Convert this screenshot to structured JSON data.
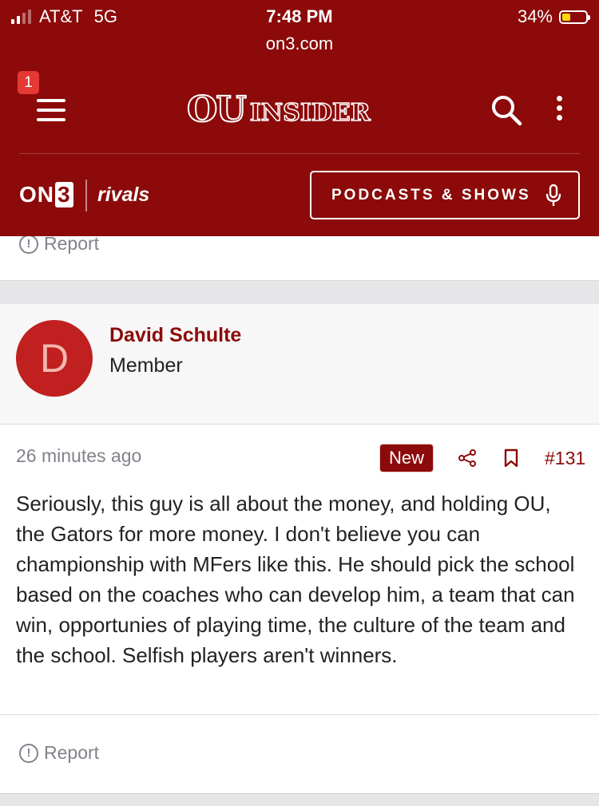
{
  "status_bar": {
    "carrier": "AT&T",
    "network": "5G",
    "time": "7:48 PM",
    "battery": "34%",
    "battery_level": 0.34
  },
  "url": "on3.com",
  "header": {
    "notification_count": "1",
    "logo_ou": "OU",
    "logo_insider": "INSIDER",
    "on3_label": "ON",
    "on3_num": "3",
    "rivals_label": "rivals",
    "podcasts_label": "PODCASTS & SHOWS"
  },
  "previous_post": {
    "report_label": "Report"
  },
  "post": {
    "author": {
      "initial": "D",
      "name": "David Schulte",
      "role": "Member"
    },
    "time_ago": "26 minutes ago",
    "new_badge": "New",
    "number": "#131",
    "body": "Seriously, this guy is all about the money, and holding OU, the Gators for more money. I don't believe you can championship with MFers like this. He should pick the school based on the coaches who can develop him, a team that can win, opportunies of playing time, the culture of the team and the school. Selfish players aren't winners.",
    "report_label": "Report"
  },
  "colors": {
    "brand": "#8c0a0a",
    "avatar_bg": "#c0201f",
    "muted": "#7f838a"
  },
  "icons": [
    "menu-icon",
    "search-icon",
    "more-vertical-icon",
    "mic-icon",
    "report-icon",
    "share-icon",
    "bookmark-icon"
  ]
}
